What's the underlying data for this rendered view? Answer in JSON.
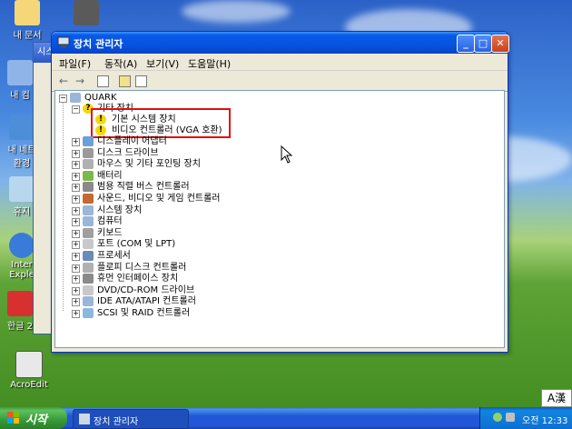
{
  "desktop": {
    "icons": [
      {
        "label": "내 문서"
      },
      {
        "label": "내 컴"
      },
      {
        "label": "내 네트"
      },
      {
        "label": "환경"
      },
      {
        "label": "휴지"
      },
      {
        "label": "Inter"
      },
      {
        "label": "Exple"
      },
      {
        "label": "한글 2"
      },
      {
        "label": "AcroEdit"
      }
    ],
    "back_window_title": "시스"
  },
  "window": {
    "title": "장치 관리자",
    "buttons": {
      "minimize": "_",
      "maximize": "□",
      "close": "✕"
    },
    "menu": [
      "파일(F)",
      "동작(A)",
      "보기(V)",
      "도움말(H)"
    ],
    "toolbar": {
      "back": "←",
      "forward": "→"
    }
  },
  "tree": {
    "root": "QUARK",
    "other_devices": "기타 장치",
    "other_children": [
      "기본 시스템 장치",
      "비디오 컨트롤러 (VGA 호환)"
    ],
    "categories": [
      "디스플레이 어댑터",
      "디스크 드라이브",
      "마우스 및 기타 포인팅 장치",
      "배터리",
      "범용 직렬 버스 컨트롤러",
      "사운드, 비디오 및 게임 컨트롤러",
      "시스템 장치",
      "컴퓨터",
      "키보드",
      "포트 (COM 및 LPT)",
      "프로세서",
      "플로피 디스크 컨트롤러",
      "휴먼 인터페이스 장치",
      "DVD/CD-ROM 드라이브",
      "IDE ATA/ATAPI 컨트롤러",
      "SCSI 및 RAID 컨트롤러"
    ]
  },
  "taskbar": {
    "start_label": "시작",
    "task_label": "장치 관리자",
    "clock": "오전 12:33",
    "ime": "A漢"
  }
}
